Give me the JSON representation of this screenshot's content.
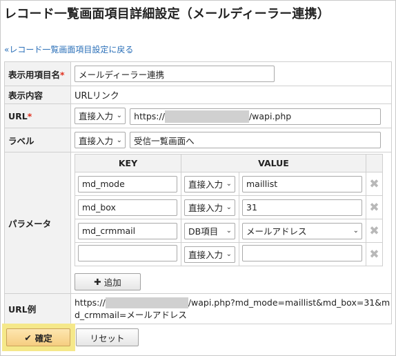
{
  "page": {
    "title": "レコード一覧画面項目詳細設定（メールディーラー連携）",
    "back_link": "«レコード一覧画面項目設定に戻る"
  },
  "form": {
    "display_name": {
      "label": "表示用項目名",
      "required_mark": "*",
      "value": "メールディーラー連携"
    },
    "content": {
      "label": "表示内容",
      "value": "URLリンク"
    },
    "url": {
      "label": "URL",
      "required_mark": "*",
      "mode": "直接入力",
      "value_prefix": "https://",
      "value_suffix": "/wapi.php"
    },
    "label": {
      "label": "ラベル",
      "mode": "直接入力",
      "value": "受信一覧画面へ"
    },
    "params": {
      "label": "パラメータ",
      "columns": {
        "key": "KEY",
        "value": "VALUE"
      },
      "rows": [
        {
          "key": "md_mode",
          "mode": "直接入力",
          "value": "maillist",
          "value_is_select": false
        },
        {
          "key": "md_box",
          "mode": "直接入力",
          "value": "31",
          "value_is_select": false
        },
        {
          "key": "md_crmmail",
          "mode": "DB項目",
          "value": "メールアドレス",
          "value_is_select": true
        },
        {
          "key": "",
          "mode": "直接入力",
          "value": "",
          "value_is_select": false
        }
      ],
      "delete_glyph": "✖",
      "add_label": "追加"
    },
    "url_example": {
      "label": "URL例",
      "line1_prefix": "https://",
      "line1_suffix": "/wapi.php?md_mode=maillist&md_box=31&m",
      "line2": "d_crmmail=メールアドレス"
    }
  },
  "actions": {
    "confirm_label": "確定",
    "reset_label": "リセット"
  },
  "colors": {
    "accent_link": "#2a6fb8",
    "required": "#e0301e",
    "highlight": "#f5e88a"
  }
}
